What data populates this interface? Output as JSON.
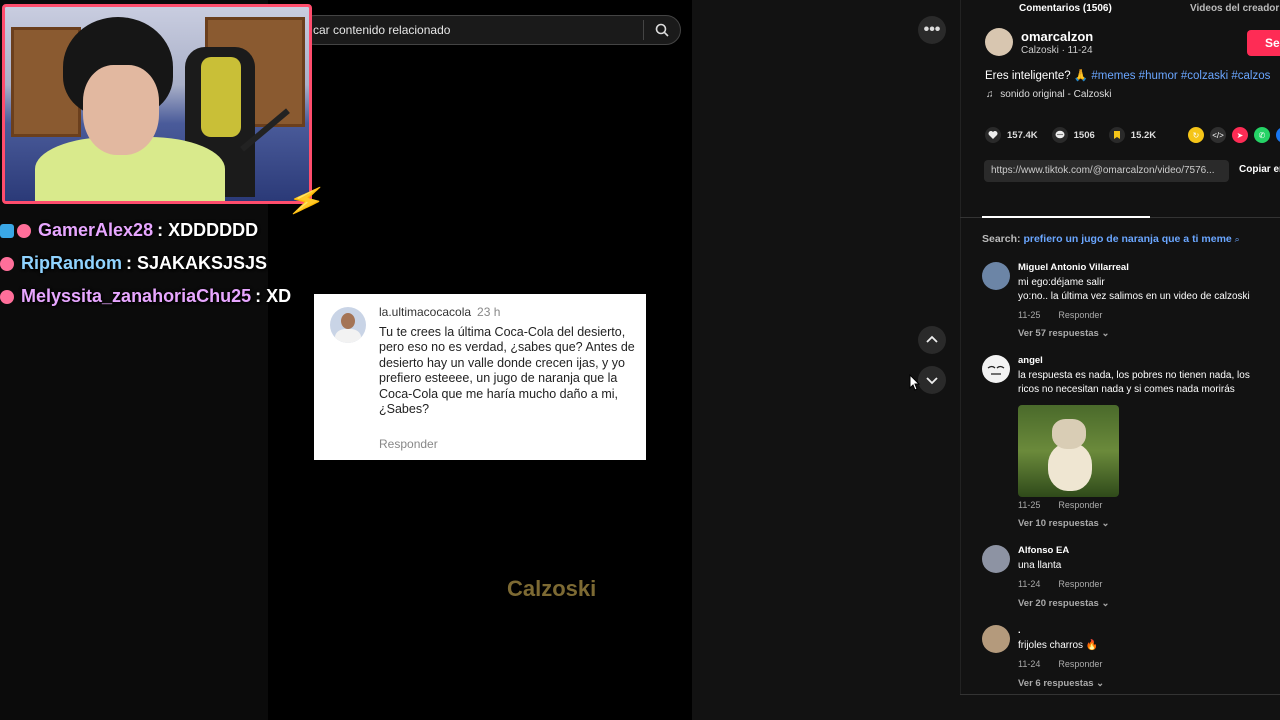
{
  "search": {
    "text": "car contenido relacionado"
  },
  "chat": [
    {
      "user": "GamerAlex28",
      "message": ": XDDDDDD",
      "color": "#e7a6ff"
    },
    {
      "user": "RipRandom",
      "message": ": SJAKAKSJSJS",
      "color": "#8fd3ff"
    },
    {
      "user": "Melyssita_zanahoriaChu25",
      "message": ": XD",
      "color": "#e7a6ff"
    }
  ],
  "comment_card": {
    "user": "la.ultimacocacola",
    "time": "23 h",
    "text": "Tu te crees la última Coca-Cola del desierto, pero eso no es verdad, ¿sabes que? Antes de desierto hay un valle donde crecen ijas, y yo prefiero esteeee, un jugo de naranja que la Coca-Cola que me haría mucho daño a mi, ¿Sabes?",
    "reply": "Responder"
  },
  "watermark": "Calzoski",
  "creator": {
    "name": "omarcalzon",
    "sub": "Calzoski · 11-24",
    "follow": "Seg",
    "caption_text": "Eres inteligente? 🙏",
    "caption_tags": "#memes #humor #colzaski #calzos",
    "sound": "sonido original - Calzoski"
  },
  "stats": {
    "likes": "157.4K",
    "comments": "1506",
    "saves": "15.2K"
  },
  "link": {
    "url": "https://www.tiktok.com/@omarcalzon/video/7576...",
    "copy": "Copiar en"
  },
  "tabs": {
    "comments": "Comentarios (1506)",
    "creator_videos": "Videos del creador"
  },
  "comment_search": {
    "label": "Search:",
    "query": "prefiero un jugo de naranja que a ti meme"
  },
  "comments": [
    {
      "user": "Miguel Antonio Villarreal",
      "line1": "mi ego:déjame salir",
      "line2": "yo:no.. la última vez salimos en un video de calzoski",
      "date": "11-25",
      "reply": "Responder",
      "replies": "Ver 57 respuestas ⌄"
    },
    {
      "user": "angel",
      "line1": "la respuesta es nada, los pobres no tienen nada, los",
      "line2": "ricos no necesitan nada y si comes nada morirás",
      "date": "11-25",
      "reply": "Responder",
      "replies": "Ver 10 respuestas ⌄"
    },
    {
      "user": "Alfonso EA",
      "line1": "una llanta",
      "date": "11-24",
      "reply": "Responder",
      "replies": "Ver 20 respuestas ⌄"
    },
    {
      "user": ".",
      "line1": "frijoles charros 🔥",
      "date": "11-24",
      "reply": "Responder",
      "replies": "Ver 6 respuestas ⌄"
    }
  ]
}
